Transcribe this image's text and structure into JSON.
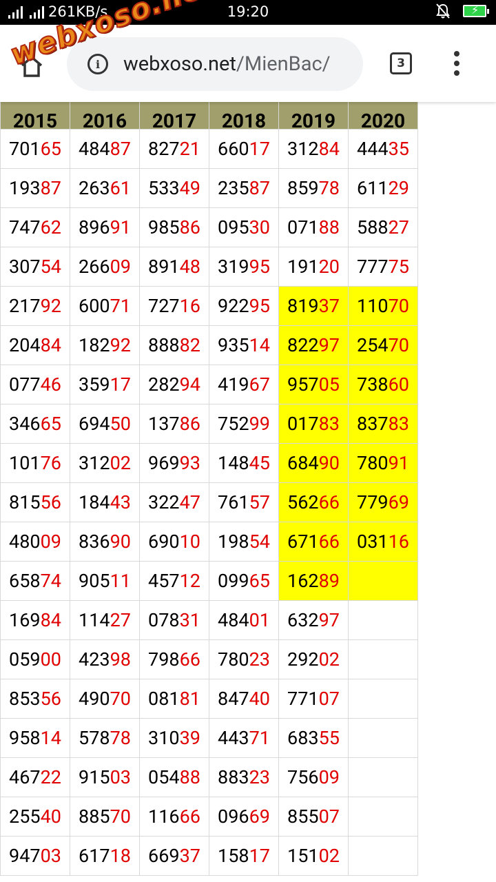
{
  "status": {
    "speed": "261KB/s",
    "time": "19:20"
  },
  "browser": {
    "url_domain": "webxoso.net",
    "url_path": "/MienBac/",
    "tab_count": "3"
  },
  "watermark": {
    "text": "webxoso.net"
  },
  "table": {
    "headers": [
      "2015",
      "2016",
      "2017",
      "2018",
      "2019",
      "2020"
    ],
    "rows": [
      [
        {
          "a": "701",
          "b": "65"
        },
        {
          "a": "484",
          "b": "87"
        },
        {
          "a": "827",
          "b": "21"
        },
        {
          "a": "660",
          "b": "17"
        },
        {
          "a": "312",
          "b": "84"
        },
        {
          "a": "444",
          "b": "35"
        }
      ],
      [
        {
          "a": "193",
          "b": "87"
        },
        {
          "a": "263",
          "b": "61"
        },
        {
          "a": "533",
          "b": "49"
        },
        {
          "a": "235",
          "b": "87"
        },
        {
          "a": "859",
          "b": "78"
        },
        {
          "a": "611",
          "b": "29"
        }
      ],
      [
        {
          "a": "747",
          "b": "62"
        },
        {
          "a": "896",
          "b": "91"
        },
        {
          "a": "985",
          "b": "86"
        },
        {
          "a": "095",
          "b": "30"
        },
        {
          "a": "071",
          "b": "88"
        },
        {
          "a": "588",
          "b": "27"
        }
      ],
      [
        {
          "a": "307",
          "b": "54"
        },
        {
          "a": "266",
          "b": "09"
        },
        {
          "a": "891",
          "b": "48"
        },
        {
          "a": "319",
          "b": "95"
        },
        {
          "a": "191",
          "b": "20"
        },
        {
          "a": "777",
          "b": "75"
        }
      ],
      [
        {
          "a": "217",
          "b": "92"
        },
        {
          "a": "600",
          "b": "71"
        },
        {
          "a": "727",
          "b": "16"
        },
        {
          "a": "922",
          "b": "95"
        },
        {
          "a": "819",
          "b": "37",
          "hl": true
        },
        {
          "a": "110",
          "b": "70",
          "hl": true
        }
      ],
      [
        {
          "a": "204",
          "b": "84"
        },
        {
          "a": "182",
          "b": "92"
        },
        {
          "a": "888",
          "b": "82"
        },
        {
          "a": "935",
          "b": "14"
        },
        {
          "a": "822",
          "b": "97",
          "hl": true
        },
        {
          "a": "254",
          "b": "70",
          "hl": true
        }
      ],
      [
        {
          "a": "077",
          "b": "46"
        },
        {
          "a": "359",
          "b": "17"
        },
        {
          "a": "282",
          "b": "94"
        },
        {
          "a": "419",
          "b": "67"
        },
        {
          "a": "957",
          "b": "05",
          "hl": true
        },
        {
          "a": "738",
          "b": "60",
          "hl": true
        }
      ],
      [
        {
          "a": "346",
          "b": "65"
        },
        {
          "a": "694",
          "b": "50"
        },
        {
          "a": "137",
          "b": "86"
        },
        {
          "a": "752",
          "b": "99"
        },
        {
          "a": "017",
          "b": "83",
          "hl": true
        },
        {
          "a": "837",
          "b": "83",
          "hl": true
        }
      ],
      [
        {
          "a": "101",
          "b": "76"
        },
        {
          "a": "312",
          "b": "02"
        },
        {
          "a": "969",
          "b": "93"
        },
        {
          "a": "148",
          "b": "45"
        },
        {
          "a": "684",
          "b": "90",
          "hl": true
        },
        {
          "a": "780",
          "b": "91",
          "hl": true
        }
      ],
      [
        {
          "a": "815",
          "b": "56"
        },
        {
          "a": "184",
          "b": "43"
        },
        {
          "a": "322",
          "b": "47"
        },
        {
          "a": "761",
          "b": "57"
        },
        {
          "a": "562",
          "b": "66",
          "hl": true
        },
        {
          "a": "779",
          "b": "69",
          "hl": true
        }
      ],
      [
        {
          "a": "480",
          "b": "09"
        },
        {
          "a": "836",
          "b": "90"
        },
        {
          "a": "690",
          "b": "10"
        },
        {
          "a": "198",
          "b": "54"
        },
        {
          "a": "671",
          "b": "66",
          "hl": true
        },
        {
          "a": "031",
          "b": "16",
          "hl": true
        }
      ],
      [
        {
          "a": "658",
          "b": "74"
        },
        {
          "a": "905",
          "b": "11"
        },
        {
          "a": "457",
          "b": "12"
        },
        {
          "a": "099",
          "b": "65"
        },
        {
          "a": "162",
          "b": "89",
          "hl": true
        },
        {
          "a": "",
          "b": "",
          "hl": true
        }
      ],
      [
        {
          "a": "169",
          "b": "84"
        },
        {
          "a": "114",
          "b": "27"
        },
        {
          "a": "078",
          "b": "31"
        },
        {
          "a": "484",
          "b": "01"
        },
        {
          "a": "632",
          "b": "97"
        },
        {
          "a": "",
          "b": ""
        }
      ],
      [
        {
          "a": "059",
          "b": "00"
        },
        {
          "a": "423",
          "b": "98"
        },
        {
          "a": "798",
          "b": "66"
        },
        {
          "a": "780",
          "b": "23"
        },
        {
          "a": "292",
          "b": "02"
        },
        {
          "a": "",
          "b": ""
        }
      ],
      [
        {
          "a": "853",
          "b": "56"
        },
        {
          "a": "490",
          "b": "70"
        },
        {
          "a": "081",
          "b": "81"
        },
        {
          "a": "847",
          "b": "40"
        },
        {
          "a": "771",
          "b": "07"
        },
        {
          "a": "",
          "b": ""
        }
      ],
      [
        {
          "a": "958",
          "b": "14"
        },
        {
          "a": "578",
          "b": "78"
        },
        {
          "a": "310",
          "b": "39"
        },
        {
          "a": "443",
          "b": "71"
        },
        {
          "a": "683",
          "b": "55"
        },
        {
          "a": "",
          "b": ""
        }
      ],
      [
        {
          "a": "467",
          "b": "22"
        },
        {
          "a": "915",
          "b": "03"
        },
        {
          "a": "054",
          "b": "88"
        },
        {
          "a": "883",
          "b": "23"
        },
        {
          "a": "756",
          "b": "09"
        },
        {
          "a": "",
          "b": ""
        }
      ],
      [
        {
          "a": "255",
          "b": "40"
        },
        {
          "a": "885",
          "b": "70"
        },
        {
          "a": "116",
          "b": "66"
        },
        {
          "a": "096",
          "b": "69"
        },
        {
          "a": "855",
          "b": "07"
        },
        {
          "a": "",
          "b": ""
        }
      ],
      [
        {
          "a": "947",
          "b": "03"
        },
        {
          "a": "617",
          "b": "18"
        },
        {
          "a": "669",
          "b": "37"
        },
        {
          "a": "158",
          "b": "17"
        },
        {
          "a": "151",
          "b": "02"
        },
        {
          "a": "",
          "b": ""
        }
      ]
    ]
  },
  "colors": {
    "header_bg": "#a19f6c",
    "highlight": "#ffff00",
    "suffix_red": "#e00000"
  }
}
